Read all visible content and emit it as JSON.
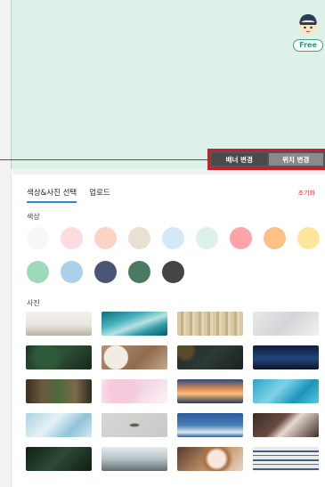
{
  "banner": {
    "free_label": "Free",
    "banner_change_label": "배너 변경",
    "position_change_label": "위치 변경"
  },
  "panel": {
    "tabs": [
      {
        "label": "색상&사진 선택",
        "active": true
      },
      {
        "label": "업로드",
        "active": false
      }
    ],
    "reset_label": "초기화",
    "colors_label": "색상",
    "photos_label": "사진"
  },
  "colors": [
    "#f7f7f7",
    "#fcdcdf",
    "#fdd3c5",
    "#eae0d2",
    "#d4e9f6",
    "#dbf1ea",
    "#fea3a7",
    "#fbc185",
    "#fde59a",
    "#9dd9bb",
    "#acd0ea",
    "#495575",
    "#4a7a62",
    "#444444"
  ],
  "photos": [
    {
      "name": "beach-photo",
      "bg": "linear-gradient(180deg,#f2f1ee 0%,#e9e6e0 55%,#b9b2a4 100%)"
    },
    {
      "name": "teal-waves-photo",
      "bg": "linear-gradient(160deg,#0e6d7a 0%,#49b4bd 35%,#b7e2e2 55%,#2f97a5 75%,#0b5b66 100%)"
    },
    {
      "name": "wood-stripes-photo",
      "bg": "repeating-linear-gradient(90deg,#d8c8a3 0 4px,#c4b083 4px 7px,#e2d6b8 7px 10px)"
    },
    {
      "name": "snow-photo",
      "bg": "linear-gradient(135deg,#e9e9ea 0%,#d4d5d8 50%,#f1f1f1 100%)"
    },
    {
      "name": "dark-leaves-photo",
      "bg": "radial-gradient(circle at 30% 40%,#2f5a3a 0 20%,transparent 40%),linear-gradient(135deg,#1d3524 0%,#2f4f35 50%,#16281a 100%)"
    },
    {
      "name": "coffee-table-photo",
      "bg": "radial-gradient(circle at 22% 50%,#f1ece4 0 22%,transparent 24%),linear-gradient(135deg,#b39173 0%,#8f6a4f 60%,#c9a98a 100%)"
    },
    {
      "name": "dark-texture-photo",
      "bg": "radial-gradient(circle at 12% 20%,#5a4a2c 0 12%,transparent 20%),linear-gradient(135deg,#1f2a2a 0%,#2d3a35 50%,#1a2222 100%)"
    },
    {
      "name": "starry-forest-photo",
      "bg": "linear-gradient(180deg,#0f1d3c 0%,#22467a 55%,#0a1428 100%)"
    },
    {
      "name": "cactus-photo",
      "bg": "linear-gradient(90deg,#3a2e23 0%,#6d5a3f 25%,#4b6a3c 50%,#7c6a49 75%,#2f2a24 100%)"
    },
    {
      "name": "pink-blossom-photo",
      "bg": "radial-gradient(circle at 30% 40%,#f6c9dd 0 25%,transparent 45%),linear-gradient(135deg,#fbe7f0 0%,#f2d3e3 50%,#fdf2f6 100%)"
    },
    {
      "name": "sunset-photo",
      "bg": "linear-gradient(180deg,#2c4a7a 0%,#f0945a 45%,#f6c27a 60%,#2b3a5c 100%)"
    },
    {
      "name": "pool-water-photo",
      "bg": "linear-gradient(135deg,#2aa5c9 0%,#7fd4e6 40%,#1d93bb 70%,#5cc5dd 100%)"
    },
    {
      "name": "frost-photo",
      "bg": "linear-gradient(135deg,#a9d2e3 0%,#e6f2f6 40%,#8fc2d8 70%,#d4e9f1 100%)"
    },
    {
      "name": "gray-leaf-photo",
      "bg": "radial-gradient(ellipse at 50% 50%,#506a52 0 8%,transparent 12%),linear-gradient(135deg,#d6d6d4 0%,#c9c9c7 100%)"
    },
    {
      "name": "clouds-sky-photo",
      "bg": "linear-gradient(180deg,#2a5d99 0%,#4b7fb8 50%,#dfe9f2 80%,#2d5f98 100%)"
    },
    {
      "name": "splash-photo",
      "bg": "linear-gradient(135deg,#3b2b27 0%,#6a4a3f 40%,#e7d9d2 55%,#3f2e28 100%)"
    },
    {
      "name": "palm-leaves-photo",
      "bg": "linear-gradient(135deg,#102018 0%,#2d4a34 50%,#0f1c14 100%)"
    },
    {
      "name": "misty-forest-photo",
      "bg": "linear-gradient(180deg,#e7eaec 0%,#b7c2c6 50%,#5f6e70 100%)"
    },
    {
      "name": "latte-photo",
      "bg": "radial-gradient(circle at 60% 50%,#f6e8da 0 20%,#a96f45 28%,transparent 40%),linear-gradient(135deg,#5a3b2a 0%,#c89a72 60%,#e8d7c6 100%)"
    },
    {
      "name": "building-photo",
      "bg": "repeating-linear-gradient(180deg,#e9e9ea 0 4px,#3e5e86 4px 6px,#f2f2f2 6px 9px,#c84a4a 9px 10px)"
    }
  ]
}
